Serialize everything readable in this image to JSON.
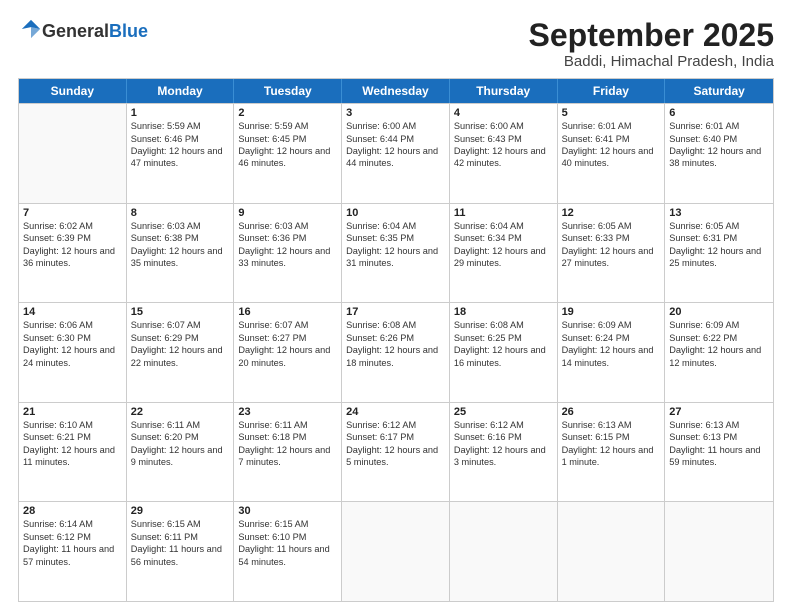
{
  "logo": {
    "general": "General",
    "blue": "Blue"
  },
  "header": {
    "month": "September 2025",
    "location": "Baddi, Himachal Pradesh, India"
  },
  "days_of_week": [
    "Sunday",
    "Monday",
    "Tuesday",
    "Wednesday",
    "Thursday",
    "Friday",
    "Saturday"
  ],
  "weeks": [
    [
      {
        "day": "",
        "sunrise": "",
        "sunset": "",
        "daylight": ""
      },
      {
        "day": "1",
        "sunrise": "Sunrise: 5:59 AM",
        "sunset": "Sunset: 6:46 PM",
        "daylight": "Daylight: 12 hours and 47 minutes."
      },
      {
        "day": "2",
        "sunrise": "Sunrise: 5:59 AM",
        "sunset": "Sunset: 6:45 PM",
        "daylight": "Daylight: 12 hours and 46 minutes."
      },
      {
        "day": "3",
        "sunrise": "Sunrise: 6:00 AM",
        "sunset": "Sunset: 6:44 PM",
        "daylight": "Daylight: 12 hours and 44 minutes."
      },
      {
        "day": "4",
        "sunrise": "Sunrise: 6:00 AM",
        "sunset": "Sunset: 6:43 PM",
        "daylight": "Daylight: 12 hours and 42 minutes."
      },
      {
        "day": "5",
        "sunrise": "Sunrise: 6:01 AM",
        "sunset": "Sunset: 6:41 PM",
        "daylight": "Daylight: 12 hours and 40 minutes."
      },
      {
        "day": "6",
        "sunrise": "Sunrise: 6:01 AM",
        "sunset": "Sunset: 6:40 PM",
        "daylight": "Daylight: 12 hours and 38 minutes."
      }
    ],
    [
      {
        "day": "7",
        "sunrise": "Sunrise: 6:02 AM",
        "sunset": "Sunset: 6:39 PM",
        "daylight": "Daylight: 12 hours and 36 minutes."
      },
      {
        "day": "8",
        "sunrise": "Sunrise: 6:03 AM",
        "sunset": "Sunset: 6:38 PM",
        "daylight": "Daylight: 12 hours and 35 minutes."
      },
      {
        "day": "9",
        "sunrise": "Sunrise: 6:03 AM",
        "sunset": "Sunset: 6:36 PM",
        "daylight": "Daylight: 12 hours and 33 minutes."
      },
      {
        "day": "10",
        "sunrise": "Sunrise: 6:04 AM",
        "sunset": "Sunset: 6:35 PM",
        "daylight": "Daylight: 12 hours and 31 minutes."
      },
      {
        "day": "11",
        "sunrise": "Sunrise: 6:04 AM",
        "sunset": "Sunset: 6:34 PM",
        "daylight": "Daylight: 12 hours and 29 minutes."
      },
      {
        "day": "12",
        "sunrise": "Sunrise: 6:05 AM",
        "sunset": "Sunset: 6:33 PM",
        "daylight": "Daylight: 12 hours and 27 minutes."
      },
      {
        "day": "13",
        "sunrise": "Sunrise: 6:05 AM",
        "sunset": "Sunset: 6:31 PM",
        "daylight": "Daylight: 12 hours and 25 minutes."
      }
    ],
    [
      {
        "day": "14",
        "sunrise": "Sunrise: 6:06 AM",
        "sunset": "Sunset: 6:30 PM",
        "daylight": "Daylight: 12 hours and 24 minutes."
      },
      {
        "day": "15",
        "sunrise": "Sunrise: 6:07 AM",
        "sunset": "Sunset: 6:29 PM",
        "daylight": "Daylight: 12 hours and 22 minutes."
      },
      {
        "day": "16",
        "sunrise": "Sunrise: 6:07 AM",
        "sunset": "Sunset: 6:27 PM",
        "daylight": "Daylight: 12 hours and 20 minutes."
      },
      {
        "day": "17",
        "sunrise": "Sunrise: 6:08 AM",
        "sunset": "Sunset: 6:26 PM",
        "daylight": "Daylight: 12 hours and 18 minutes."
      },
      {
        "day": "18",
        "sunrise": "Sunrise: 6:08 AM",
        "sunset": "Sunset: 6:25 PM",
        "daylight": "Daylight: 12 hours and 16 minutes."
      },
      {
        "day": "19",
        "sunrise": "Sunrise: 6:09 AM",
        "sunset": "Sunset: 6:24 PM",
        "daylight": "Daylight: 12 hours and 14 minutes."
      },
      {
        "day": "20",
        "sunrise": "Sunrise: 6:09 AM",
        "sunset": "Sunset: 6:22 PM",
        "daylight": "Daylight: 12 hours and 12 minutes."
      }
    ],
    [
      {
        "day": "21",
        "sunrise": "Sunrise: 6:10 AM",
        "sunset": "Sunset: 6:21 PM",
        "daylight": "Daylight: 12 hours and 11 minutes."
      },
      {
        "day": "22",
        "sunrise": "Sunrise: 6:11 AM",
        "sunset": "Sunset: 6:20 PM",
        "daylight": "Daylight: 12 hours and 9 minutes."
      },
      {
        "day": "23",
        "sunrise": "Sunrise: 6:11 AM",
        "sunset": "Sunset: 6:18 PM",
        "daylight": "Daylight: 12 hours and 7 minutes."
      },
      {
        "day": "24",
        "sunrise": "Sunrise: 6:12 AM",
        "sunset": "Sunset: 6:17 PM",
        "daylight": "Daylight: 12 hours and 5 minutes."
      },
      {
        "day": "25",
        "sunrise": "Sunrise: 6:12 AM",
        "sunset": "Sunset: 6:16 PM",
        "daylight": "Daylight: 12 hours and 3 minutes."
      },
      {
        "day": "26",
        "sunrise": "Sunrise: 6:13 AM",
        "sunset": "Sunset: 6:15 PM",
        "daylight": "Daylight: 12 hours and 1 minute."
      },
      {
        "day": "27",
        "sunrise": "Sunrise: 6:13 AM",
        "sunset": "Sunset: 6:13 PM",
        "daylight": "Daylight: 11 hours and 59 minutes."
      }
    ],
    [
      {
        "day": "28",
        "sunrise": "Sunrise: 6:14 AM",
        "sunset": "Sunset: 6:12 PM",
        "daylight": "Daylight: 11 hours and 57 minutes."
      },
      {
        "day": "29",
        "sunrise": "Sunrise: 6:15 AM",
        "sunset": "Sunset: 6:11 PM",
        "daylight": "Daylight: 11 hours and 56 minutes."
      },
      {
        "day": "30",
        "sunrise": "Sunrise: 6:15 AM",
        "sunset": "Sunset: 6:10 PM",
        "daylight": "Daylight: 11 hours and 54 minutes."
      },
      {
        "day": "",
        "sunrise": "",
        "sunset": "",
        "daylight": ""
      },
      {
        "day": "",
        "sunrise": "",
        "sunset": "",
        "daylight": ""
      },
      {
        "day": "",
        "sunrise": "",
        "sunset": "",
        "daylight": ""
      },
      {
        "day": "",
        "sunrise": "",
        "sunset": "",
        "daylight": ""
      }
    ]
  ]
}
